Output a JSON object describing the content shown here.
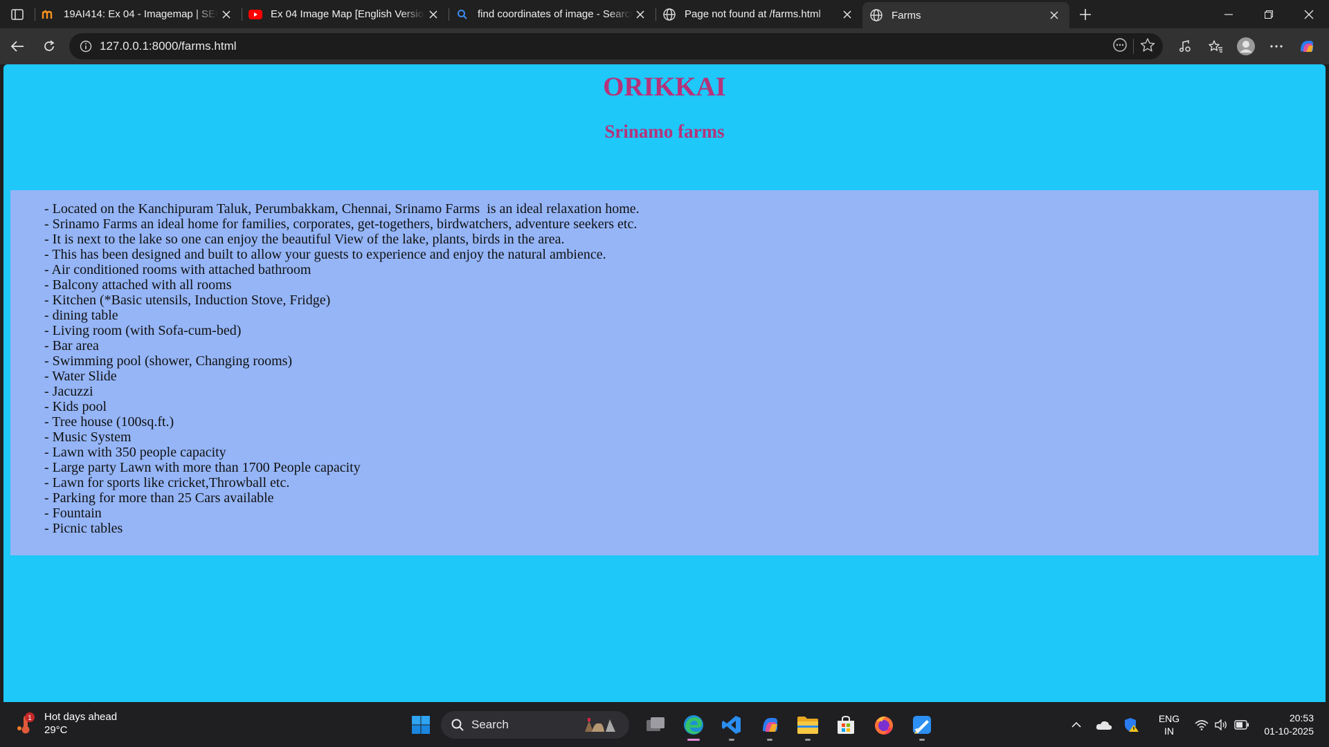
{
  "browser": {
    "tabs": [
      {
        "title": "19AI414: Ex 04 - Imagemap | SEC",
        "favicon": "moodle-icon",
        "active": false
      },
      {
        "title": "Ex 04 Image Map [English Version]",
        "favicon": "youtube-icon",
        "active": false
      },
      {
        "title": "find coordinates of image - Search",
        "favicon": "search-icon",
        "active": false
      },
      {
        "title": "Page not found at /farms.html",
        "favicon": "globe-icon",
        "active": false
      },
      {
        "title": "Farms",
        "favicon": "globe-icon",
        "active": true
      }
    ],
    "url": "127.0.0.1:8000/farms.html"
  },
  "page": {
    "heading": "ORIKKAI",
    "subheading": "Srinamo farms",
    "heading_color": "#b5337a",
    "background_color": "#1ec8f8",
    "panel_color": "#95b5f7",
    "features": [
      "- Located on the Kanchipuram Taluk, Perumbakkam, Chennai, Srinamo Farms  is an ideal relaxation home.",
      "- Srinamo Farms an ideal home for families, corporates, get-togethers, birdwatchers, adventure seekers etc.",
      "- It is next to the lake so one can enjoy the beautiful View of the lake, plants, birds in the area.",
      "- This has been designed and built to allow your guests to experience and enjoy the natural ambience.",
      "- Air conditioned rooms with attached bathroom",
      "- Balcony attached with all rooms",
      "- Kitchen (*Basic utensils, Induction Stove, Fridge)",
      "- dining table",
      "- Living room (with Sofa-cum-bed)",
      "- Bar area",
      "- Swimming pool (shower, Changing rooms)",
      "- Water Slide",
      "- Jacuzzi",
      "- Kids pool",
      "- Tree house (100sq.ft.)",
      "- Music System",
      "- Lawn with 350 people capacity",
      "- Large party Lawn with more than 1700 People capacity",
      "- Lawn for sports like cricket,Throwball etc.",
      "- Parking for more than 25 Cars available",
      "- Fountain",
      "- Picnic tables"
    ]
  },
  "taskbar": {
    "weather": {
      "title": "Hot days ahead",
      "temp": "29°C",
      "alert_badge": "1"
    },
    "search_label": "Search",
    "pinned_apps": [
      "task-view-icon",
      "edge-icon",
      "vscode-icon",
      "copilot-icon",
      "file-explorer-icon",
      "store-icon",
      "firefox-icon",
      "paint-icon"
    ],
    "language": {
      "line1": "ENG",
      "line2": "IN"
    },
    "time": "20:53",
    "date": "01-10-2025"
  }
}
